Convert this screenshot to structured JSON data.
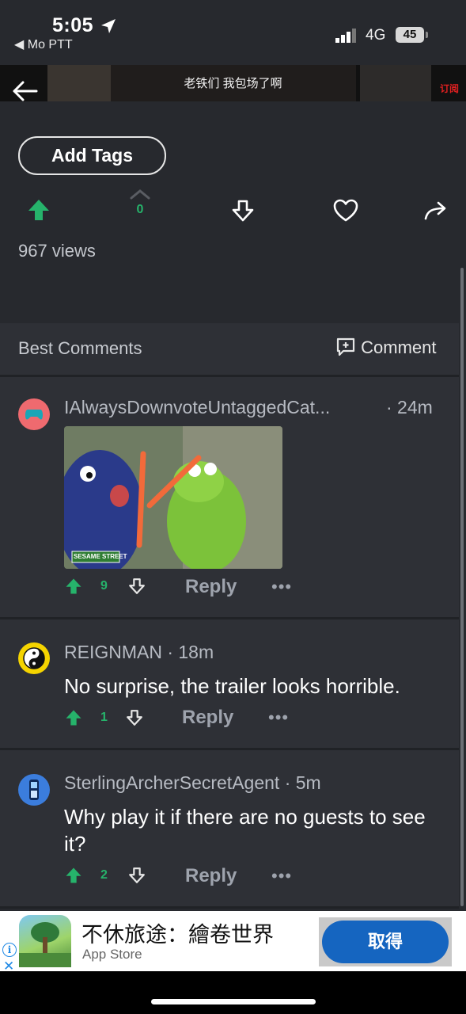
{
  "status_bar": {
    "time": "5:05",
    "back_app": "◀ Mo PTT",
    "network": "4G",
    "battery": "45"
  },
  "video": {
    "caption": "老铁们 我包场了啊",
    "badge": "订阅"
  },
  "tags": {
    "add_label": "Add Tags"
  },
  "actions": {
    "vote_count": "0",
    "views": "967 views"
  },
  "comments_header": {
    "title": "Best Comments",
    "comment_button": "Comment"
  },
  "comments": [
    {
      "user": "IAlwaysDownvoteUntaggedCat...",
      "time": "· 24m",
      "text": "",
      "votes": "9",
      "reply": "Reply",
      "more": "•••",
      "gif_label": "SESAME STREET"
    },
    {
      "user": "REIGNMAN",
      "time": "· 18m",
      "text": "No surprise, the trailer looks horrible.",
      "votes": "1",
      "reply": "Reply",
      "more": "•••"
    },
    {
      "user": "SterlingArcherSecretAgent",
      "time": "· 5m",
      "text": "Why play it if there are no guests to see it?",
      "votes": "2",
      "reply": "Reply",
      "more": "•••"
    }
  ],
  "ad": {
    "title": "不休旅途：繪卷世界",
    "subtitle": "App Store",
    "button": "取得",
    "info": "i",
    "close": "✕"
  },
  "colors": {
    "upvote": "#26b36b",
    "background": "#27292e",
    "card": "#2e3036",
    "ad_button": "#1565c0"
  }
}
